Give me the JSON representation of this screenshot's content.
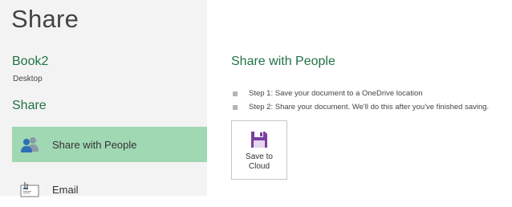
{
  "header": {
    "title": "Share"
  },
  "document": {
    "name": "Book2",
    "location": "Desktop"
  },
  "sidebar": {
    "heading": "Share",
    "items": [
      {
        "label": "Share with People",
        "icon": "people-icon",
        "active": true
      },
      {
        "label": "Email",
        "icon": "email-icon",
        "active": false
      }
    ]
  },
  "main": {
    "title": "Share with People",
    "steps": [
      "Step 1: Save your document to a OneDrive location",
      "Step 2: Share your document. We'll do this after you've finished saving."
    ],
    "save_button": {
      "line1": "Save to",
      "line2": "Cloud",
      "icon": "floppy-disk-icon"
    }
  },
  "colors": {
    "accent": "#217346",
    "active_item_bg": "#a0d8b3",
    "left_pane_bg": "#f3f3f3",
    "save_icon": "#7b3fa0"
  }
}
